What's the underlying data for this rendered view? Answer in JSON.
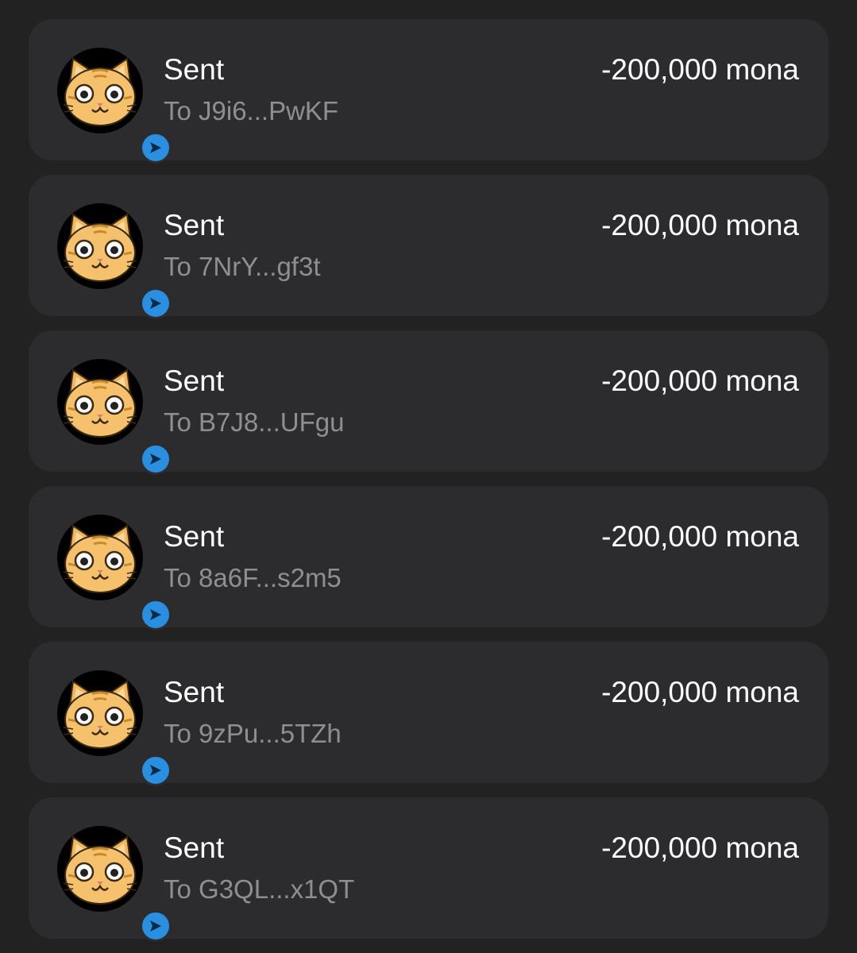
{
  "transactions": [
    {
      "title": "Sent",
      "recipient": "To J9i6...PwKF",
      "amount": "-200,000 mona"
    },
    {
      "title": "Sent",
      "recipient": "To 7NrY...gf3t",
      "amount": "-200,000 mona"
    },
    {
      "title": "Sent",
      "recipient": "To B7J8...UFgu",
      "amount": "-200,000 mona"
    },
    {
      "title": "Sent",
      "recipient": "To 8a6F...s2m5",
      "amount": "-200,000 mona"
    },
    {
      "title": "Sent",
      "recipient": "To 9zPu...5TZh",
      "amount": "-200,000 mona"
    },
    {
      "title": "Sent",
      "recipient": "To G3QL...x1QT",
      "amount": "-200,000 mona"
    }
  ],
  "icons": {
    "avatar": "cat-token-icon",
    "badge": "send-arrow-icon"
  },
  "colors": {
    "background": "#222222",
    "card": "#2c2c2f",
    "primary_text": "#ffffff",
    "secondary_text": "#8e8e93",
    "badge": "#2a8fe0"
  }
}
